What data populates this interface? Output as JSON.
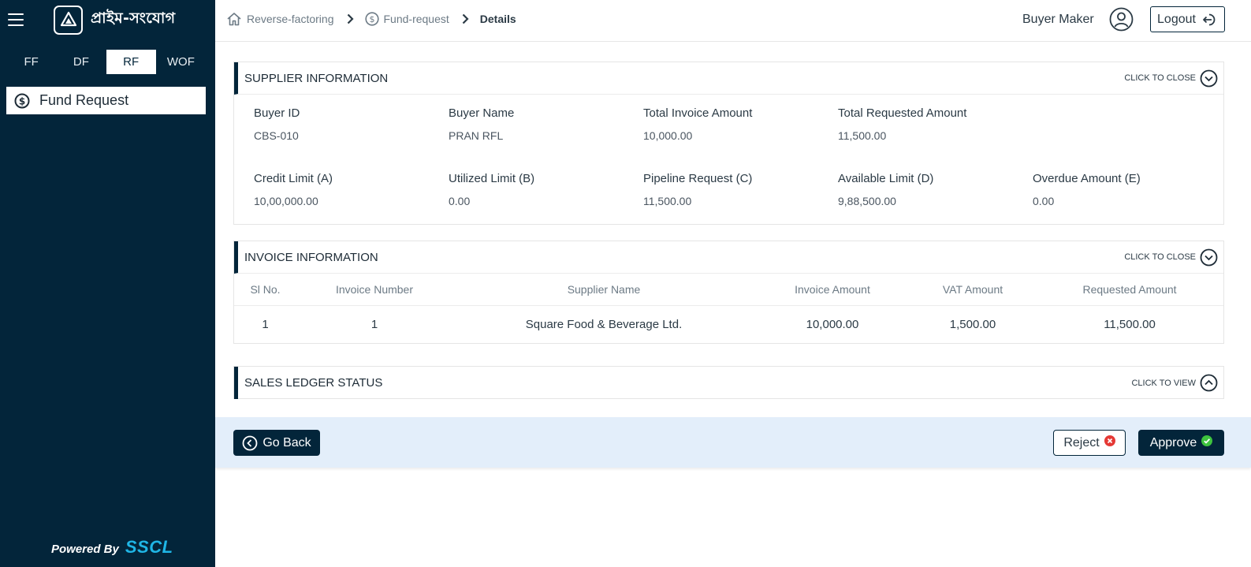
{
  "sidebar": {
    "brand": "প্রাইম-সংযোগ",
    "modules": [
      {
        "label": "FF",
        "active": false
      },
      {
        "label": "DF",
        "active": false
      },
      {
        "label": "RF",
        "active": true
      },
      {
        "label": "WOF",
        "active": false
      }
    ],
    "menu": {
      "label": "Fund Request"
    },
    "powered_by": "Powered By",
    "powered_brand": "SSCL"
  },
  "header": {
    "breadcrumbs": [
      {
        "label": "Reverse-factoring",
        "icon": "home-icon"
      },
      {
        "label": "Fund-request",
        "icon": "dollar-circle-icon"
      },
      {
        "label": "Details"
      }
    ],
    "user_name": "Buyer Maker",
    "logout_label": "Logout"
  },
  "supplier_info": {
    "title": "SUPPLIER INFORMATION",
    "toggle_label": "CLICK TO CLOSE",
    "rows": [
      [
        {
          "label": "Buyer ID",
          "value": "CBS-010"
        },
        {
          "label": "Buyer Name",
          "value": "PRAN RFL"
        },
        {
          "label": "Total Invoice Amount",
          "value": "10,000.00"
        },
        {
          "label": "Total Requested Amount",
          "value": "11,500.00"
        }
      ],
      [
        {
          "label": "Credit Limit (A)",
          "value": "10,00,000.00"
        },
        {
          "label": "Utilized Limit (B)",
          "value": "0.00"
        },
        {
          "label": "Pipeline Request (C)",
          "value": "11,500.00"
        },
        {
          "label": "Available Limit (D)",
          "value": "9,88,500.00"
        },
        {
          "label": "Overdue Amount (E)",
          "value": "0.00"
        }
      ]
    ]
  },
  "invoice_info": {
    "title": "INVOICE INFORMATION",
    "toggle_label": "CLICK TO CLOSE",
    "columns": [
      "Sl No.",
      "Invoice Number",
      "Supplier Name",
      "Invoice Amount",
      "VAT Amount",
      "Requested Amount"
    ],
    "rows": [
      [
        "1",
        "1",
        "Square Food & Beverage Ltd.",
        "10,000.00",
        "1,500.00",
        "11,500.00"
      ]
    ]
  },
  "sales_ledger": {
    "title": "SALES LEDGER STATUS",
    "toggle_label": "CLICK TO VIEW"
  },
  "actions": {
    "back_label": "Go Back",
    "reject_label": "Reject",
    "approve_label": "Approve"
  },
  "colors": {
    "sidebar_bg": "#03253a",
    "action_bar_bg": "#e3eefa",
    "reject_icon": "#e53935",
    "approve_icon": "#3ec43e",
    "powered_brand": "#1fb6e6"
  }
}
